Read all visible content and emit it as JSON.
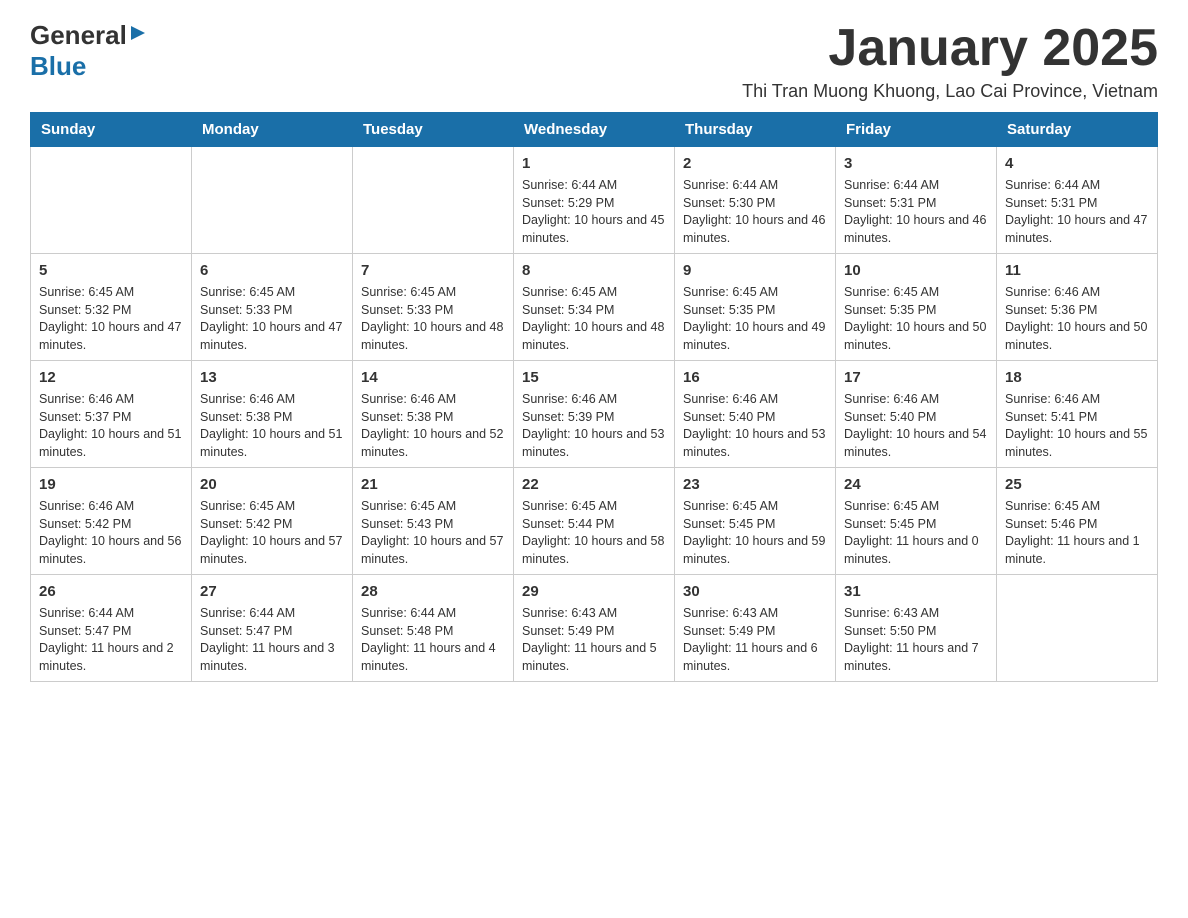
{
  "header": {
    "logo_general": "General",
    "logo_blue": "Blue",
    "month_title": "January 2025",
    "location": "Thi Tran Muong Khuong, Lao Cai Province, Vietnam"
  },
  "days_of_week": [
    "Sunday",
    "Monday",
    "Tuesday",
    "Wednesday",
    "Thursday",
    "Friday",
    "Saturday"
  ],
  "weeks": [
    [
      {
        "day": "",
        "info": ""
      },
      {
        "day": "",
        "info": ""
      },
      {
        "day": "",
        "info": ""
      },
      {
        "day": "1",
        "info": "Sunrise: 6:44 AM\nSunset: 5:29 PM\nDaylight: 10 hours and 45 minutes."
      },
      {
        "day": "2",
        "info": "Sunrise: 6:44 AM\nSunset: 5:30 PM\nDaylight: 10 hours and 46 minutes."
      },
      {
        "day": "3",
        "info": "Sunrise: 6:44 AM\nSunset: 5:31 PM\nDaylight: 10 hours and 46 minutes."
      },
      {
        "day": "4",
        "info": "Sunrise: 6:44 AM\nSunset: 5:31 PM\nDaylight: 10 hours and 47 minutes."
      }
    ],
    [
      {
        "day": "5",
        "info": "Sunrise: 6:45 AM\nSunset: 5:32 PM\nDaylight: 10 hours and 47 minutes."
      },
      {
        "day": "6",
        "info": "Sunrise: 6:45 AM\nSunset: 5:33 PM\nDaylight: 10 hours and 47 minutes."
      },
      {
        "day": "7",
        "info": "Sunrise: 6:45 AM\nSunset: 5:33 PM\nDaylight: 10 hours and 48 minutes."
      },
      {
        "day": "8",
        "info": "Sunrise: 6:45 AM\nSunset: 5:34 PM\nDaylight: 10 hours and 48 minutes."
      },
      {
        "day": "9",
        "info": "Sunrise: 6:45 AM\nSunset: 5:35 PM\nDaylight: 10 hours and 49 minutes."
      },
      {
        "day": "10",
        "info": "Sunrise: 6:45 AM\nSunset: 5:35 PM\nDaylight: 10 hours and 50 minutes."
      },
      {
        "day": "11",
        "info": "Sunrise: 6:46 AM\nSunset: 5:36 PM\nDaylight: 10 hours and 50 minutes."
      }
    ],
    [
      {
        "day": "12",
        "info": "Sunrise: 6:46 AM\nSunset: 5:37 PM\nDaylight: 10 hours and 51 minutes."
      },
      {
        "day": "13",
        "info": "Sunrise: 6:46 AM\nSunset: 5:38 PM\nDaylight: 10 hours and 51 minutes."
      },
      {
        "day": "14",
        "info": "Sunrise: 6:46 AM\nSunset: 5:38 PM\nDaylight: 10 hours and 52 minutes."
      },
      {
        "day": "15",
        "info": "Sunrise: 6:46 AM\nSunset: 5:39 PM\nDaylight: 10 hours and 53 minutes."
      },
      {
        "day": "16",
        "info": "Sunrise: 6:46 AM\nSunset: 5:40 PM\nDaylight: 10 hours and 53 minutes."
      },
      {
        "day": "17",
        "info": "Sunrise: 6:46 AM\nSunset: 5:40 PM\nDaylight: 10 hours and 54 minutes."
      },
      {
        "day": "18",
        "info": "Sunrise: 6:46 AM\nSunset: 5:41 PM\nDaylight: 10 hours and 55 minutes."
      }
    ],
    [
      {
        "day": "19",
        "info": "Sunrise: 6:46 AM\nSunset: 5:42 PM\nDaylight: 10 hours and 56 minutes."
      },
      {
        "day": "20",
        "info": "Sunrise: 6:45 AM\nSunset: 5:42 PM\nDaylight: 10 hours and 57 minutes."
      },
      {
        "day": "21",
        "info": "Sunrise: 6:45 AM\nSunset: 5:43 PM\nDaylight: 10 hours and 57 minutes."
      },
      {
        "day": "22",
        "info": "Sunrise: 6:45 AM\nSunset: 5:44 PM\nDaylight: 10 hours and 58 minutes."
      },
      {
        "day": "23",
        "info": "Sunrise: 6:45 AM\nSunset: 5:45 PM\nDaylight: 10 hours and 59 minutes."
      },
      {
        "day": "24",
        "info": "Sunrise: 6:45 AM\nSunset: 5:45 PM\nDaylight: 11 hours and 0 minutes."
      },
      {
        "day": "25",
        "info": "Sunrise: 6:45 AM\nSunset: 5:46 PM\nDaylight: 11 hours and 1 minute."
      }
    ],
    [
      {
        "day": "26",
        "info": "Sunrise: 6:44 AM\nSunset: 5:47 PM\nDaylight: 11 hours and 2 minutes."
      },
      {
        "day": "27",
        "info": "Sunrise: 6:44 AM\nSunset: 5:47 PM\nDaylight: 11 hours and 3 minutes."
      },
      {
        "day": "28",
        "info": "Sunrise: 6:44 AM\nSunset: 5:48 PM\nDaylight: 11 hours and 4 minutes."
      },
      {
        "day": "29",
        "info": "Sunrise: 6:43 AM\nSunset: 5:49 PM\nDaylight: 11 hours and 5 minutes."
      },
      {
        "day": "30",
        "info": "Sunrise: 6:43 AM\nSunset: 5:49 PM\nDaylight: 11 hours and 6 minutes."
      },
      {
        "day": "31",
        "info": "Sunrise: 6:43 AM\nSunset: 5:50 PM\nDaylight: 11 hours and 7 minutes."
      },
      {
        "day": "",
        "info": ""
      }
    ]
  ]
}
